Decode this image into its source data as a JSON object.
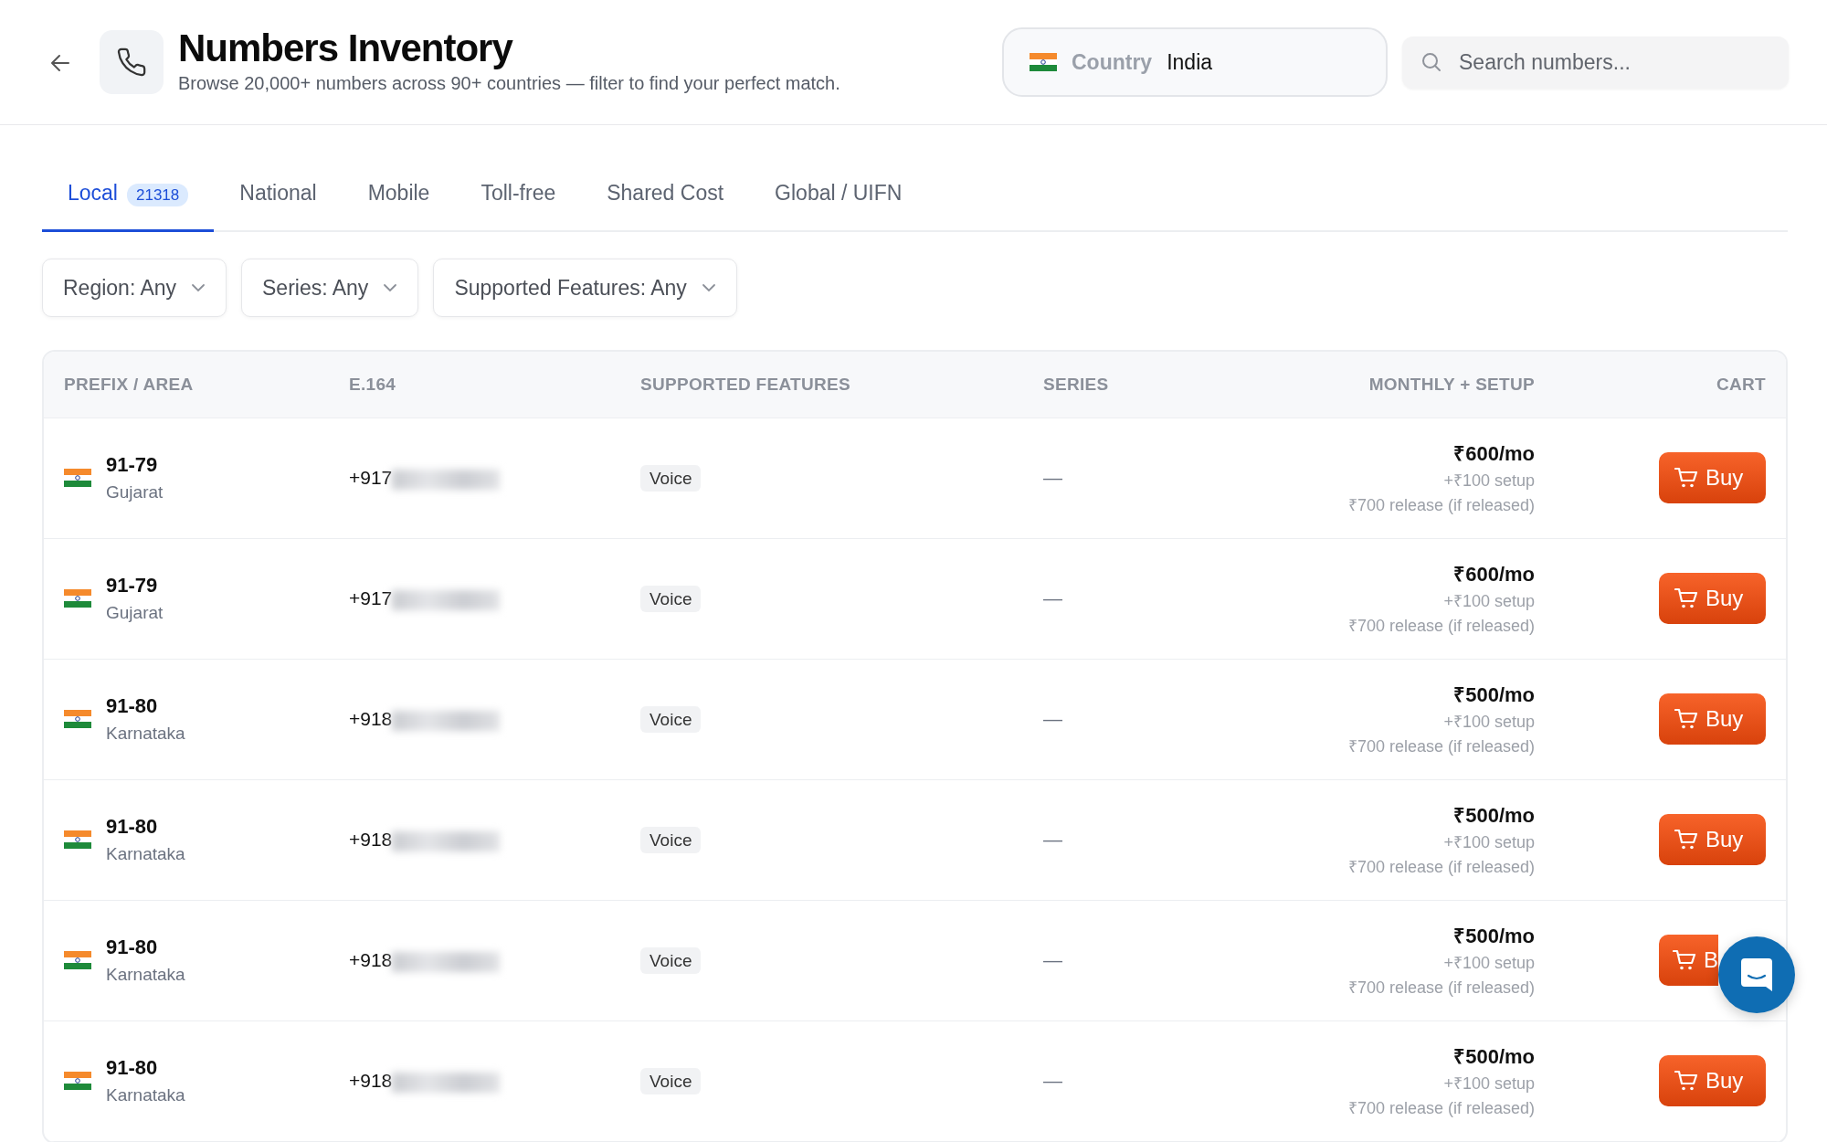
{
  "header": {
    "title": "Numbers Inventory",
    "subtitle": "Browse 20,000+ numbers across 90+ countries — filter to find your perfect match.",
    "country_label": "Country",
    "country_value": "India",
    "search": {
      "placeholder": "Search numbers..."
    }
  },
  "tabs": [
    {
      "label": "Local",
      "count": "21318",
      "selected": true
    },
    {
      "label": "National",
      "selected": false
    },
    {
      "label": "Mobile",
      "selected": false
    },
    {
      "label": "Toll-free",
      "selected": false
    },
    {
      "label": "Shared Cost",
      "selected": false
    },
    {
      "label": "Global / UIFN",
      "selected": false
    }
  ],
  "filters": [
    "Region: Any",
    "Series: Any",
    "Supported Features: Any"
  ],
  "table": {
    "columns": [
      "PREFIX / AREA",
      "E.164",
      "SUPPORTED FEATURES",
      "SERIES",
      "MONTHLY + SETUP",
      "CART"
    ],
    "rows": [
      {
        "prefix": "91-79",
        "area": "Gujarat",
        "e164": "+917",
        "feature": "Voice",
        "series": "—",
        "monthly": "₹600/mo",
        "setup": "+₹100 setup",
        "release": "₹700 release (if released)",
        "action": "Buy"
      },
      {
        "prefix": "91-79",
        "area": "Gujarat",
        "e164": "+917",
        "feature": "Voice",
        "series": "—",
        "monthly": "₹600/mo",
        "setup": "+₹100 setup",
        "release": "₹700 release (if released)",
        "action": "Buy"
      },
      {
        "prefix": "91-80",
        "area": "Karnataka",
        "e164": "+918",
        "feature": "Voice",
        "series": "—",
        "monthly": "₹500/mo",
        "setup": "+₹100 setup",
        "release": "₹700 release (if released)",
        "action": "Buy"
      },
      {
        "prefix": "91-80",
        "area": "Karnataka",
        "e164": "+918",
        "feature": "Voice",
        "series": "—",
        "monthly": "₹500/mo",
        "setup": "+₹100 setup",
        "release": "₹700 release (if released)",
        "action": "Buy"
      },
      {
        "prefix": "91-80",
        "area": "Karnataka",
        "e164": "+918",
        "feature": "Voice",
        "series": "—",
        "monthly": "₹500/mo",
        "setup": "+₹100 setup",
        "release": "₹700 release (if released)",
        "action": "B"
      },
      {
        "prefix": "91-80",
        "area": "Karnataka",
        "e164": "+918",
        "feature": "Voice",
        "series": "—",
        "monthly": "₹500/mo",
        "setup": "+₹100 setup",
        "release": "₹700 release (if released)",
        "action": "Buy"
      }
    ]
  }
}
